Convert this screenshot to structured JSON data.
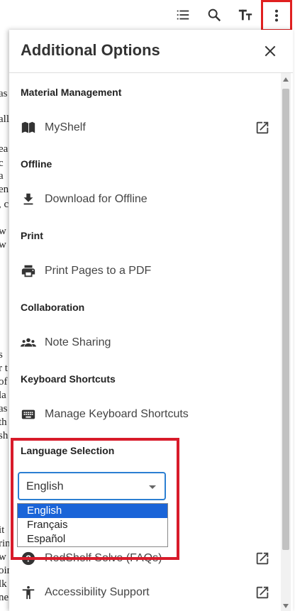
{
  "toolbar": {
    "icons": [
      "list-icon",
      "search-icon",
      "text-size-icon",
      "more-vert-icon"
    ]
  },
  "background_text": [
    "as",
    "all",
    "ea",
    "c",
    "a",
    "en",
    ", c",
    "w",
    "w",
    "s",
    "r t",
    "of",
    "la",
    "as",
    "th",
    "sh",
    "it",
    "rin",
    "w",
    "oin",
    "lk",
    "ne"
  ],
  "panel": {
    "title": "Additional Options",
    "sections": [
      {
        "label": "Material Management",
        "item": "MyShelf",
        "icon": "book-icon",
        "external": true
      },
      {
        "label": "Offline",
        "item": "Download for Offline",
        "icon": "download-icon",
        "external": false
      },
      {
        "label": "Print",
        "item": "Print Pages to a PDF",
        "icon": "print-icon",
        "external": false
      },
      {
        "label": "Collaboration",
        "item": "Note Sharing",
        "icon": "group-icon",
        "external": false
      },
      {
        "label": "Keyboard Shortcuts",
        "item": "Manage Keyboard Shortcuts",
        "icon": "keyboard-icon",
        "external": false
      }
    ],
    "language": {
      "label": "Language Selection",
      "selected": "English",
      "options": [
        "English",
        "Français",
        "Español"
      ]
    },
    "bottom_items": [
      {
        "item": "RedShelf Solve (FAQs)",
        "icon": "help-icon",
        "external": true
      },
      {
        "item": "Accessibility Support",
        "icon": "accessibility-icon",
        "external": true
      }
    ]
  }
}
